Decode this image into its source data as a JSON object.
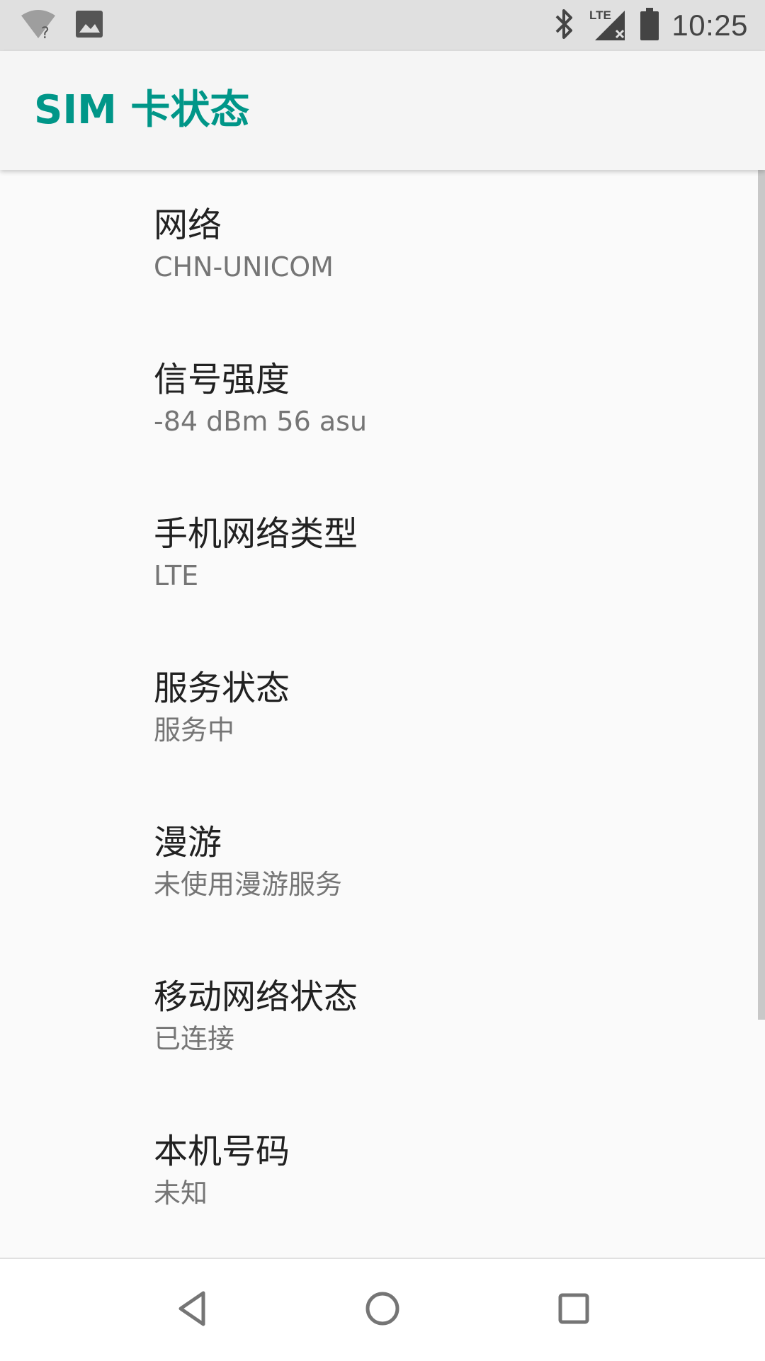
{
  "status_bar": {
    "time": "10:25",
    "icons": [
      "wifi-unknown-icon",
      "image-notification-icon",
      "bluetooth-icon",
      "lte-signal-icon",
      "battery-icon"
    ],
    "lte_label": "LTE"
  },
  "app_bar": {
    "title": "SIM 卡状态",
    "accent_color": "#009688"
  },
  "items": [
    {
      "title": "网络",
      "summary": "CHN-UNICOM"
    },
    {
      "title": "信号强度",
      "summary": "-84 dBm 56 asu"
    },
    {
      "title": "手机网络类型",
      "summary": "LTE"
    },
    {
      "title": "服务状态",
      "summary": "服务中"
    },
    {
      "title": "漫游",
      "summary": "未使用漫游服务"
    },
    {
      "title": "移动网络状态",
      "summary": "已连接"
    },
    {
      "title": "本机号码",
      "summary": "未知"
    }
  ],
  "nav_bar": {
    "buttons": [
      "back-icon",
      "home-icon",
      "recents-icon"
    ]
  }
}
